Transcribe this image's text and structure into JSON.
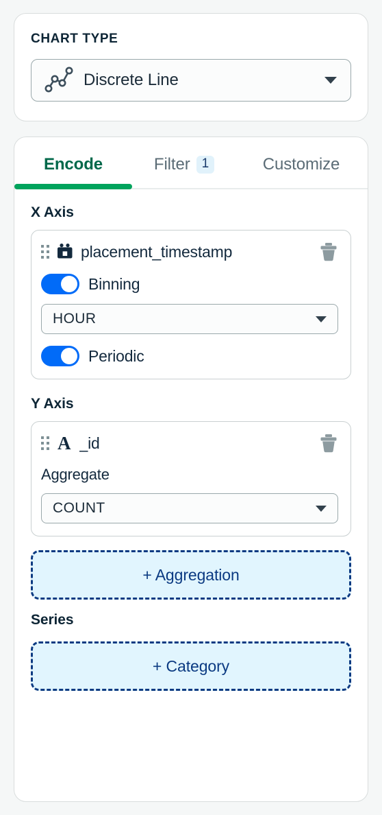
{
  "chart_type_panel": {
    "label": "CHART TYPE",
    "selected": "Discrete Line",
    "icon": "line-chart-icon",
    "caret": "chevron-down-icon"
  },
  "tabs": [
    {
      "label": "Encode",
      "active": true,
      "badge": null
    },
    {
      "label": "Filter",
      "active": false,
      "badge": "1"
    },
    {
      "label": "Customize",
      "active": false,
      "badge": null
    }
  ],
  "encode": {
    "x_axis": {
      "title": "X Axis",
      "field": {
        "name": "placement_timestamp",
        "type_icon": "calendar-icon",
        "drag_handle": "drag-handle-icon",
        "delete_icon": "trash-icon"
      },
      "binning": {
        "label": "Binning",
        "enabled": true,
        "unit": "HOUR"
      },
      "periodic": {
        "label": "Periodic",
        "enabled": true
      }
    },
    "y_axis": {
      "title": "Y Axis",
      "field": {
        "name": "_id",
        "type_icon": "string-type-icon",
        "type_glyph": "A",
        "drag_handle": "drag-handle-icon",
        "delete_icon": "trash-icon"
      },
      "aggregate": {
        "label": "Aggregate",
        "value": "COUNT"
      }
    },
    "add_aggregation_label": "+ Aggregation",
    "series": {
      "title": "Series",
      "add_category_label": "+ Category"
    }
  },
  "colors": {
    "page_background": "#f5f7f7",
    "card_background": "#ffffff",
    "card_border": "#d9dddd",
    "active_tab_text": "#00684a",
    "active_tab_indicator": "#00a35c",
    "inactive_tab_text": "#5b6c76",
    "toggle_on": "#016bf8",
    "badge_background": "#e1f2fb",
    "badge_text": "#1a3a6b",
    "add_button_background": "#e1f5fe",
    "add_button_border": "#0b3a82",
    "add_button_text": "#0b3a82",
    "heading_text": "#0d2535",
    "field_text": "#13293d",
    "trash_icon": "#8d9ba0",
    "drag_handle": "#7f9196"
  }
}
